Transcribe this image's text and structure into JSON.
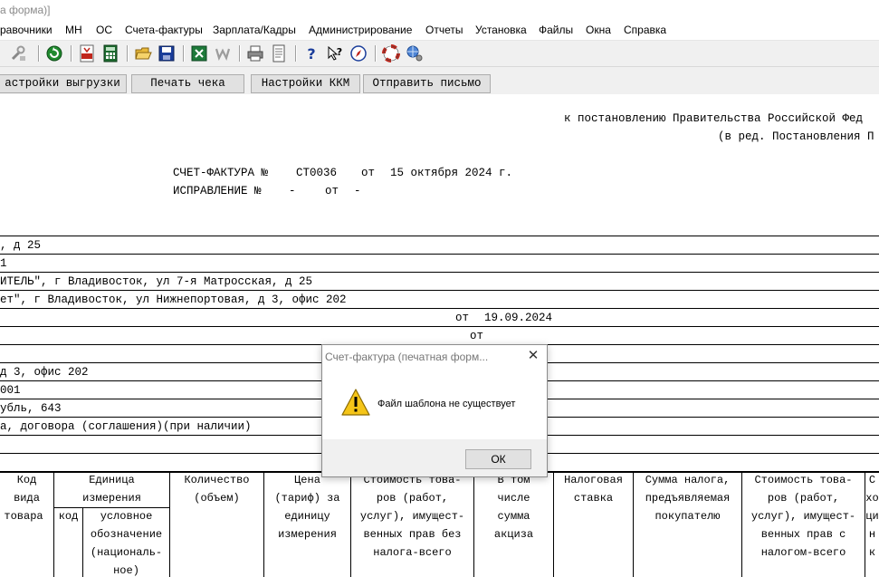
{
  "window": {
    "title": "а форма)]"
  },
  "menu": [
    "равочники",
    "МН",
    "ОС",
    "Счета-фактуры",
    "Зарплата/Кадры",
    "Администрирование",
    "Отчеты",
    "Установка",
    "Файлы",
    "Окна",
    "Справка"
  ],
  "toolbar": {
    "icons": [
      "tools-icon",
      "refresh-icon",
      "pdf-icon",
      "calculator-icon",
      "open-folder-icon",
      "save-icon",
      "excel-icon",
      "word-icon",
      "print-icon",
      "print-preview-icon",
      "help-icon",
      "context-help-icon",
      "compass-icon",
      "lifebuoy-icon",
      "web-settings-icon"
    ]
  },
  "actions": {
    "export_settings": "астройки выгрузки",
    "print_check": "Печать чека",
    "kkm_settings": "Настройки ККМ",
    "send_letter": "Отправить письмо"
  },
  "document": {
    "decree_line1": "к постановлению Правительства Российской Фед",
    "decree_line2": "(в ред. Постановления П",
    "invoice_label": "СЧЕТ-ФАКТУРА №",
    "invoice_number": "СТ0036",
    "from_label": "от",
    "invoice_date": "15 октября 2024 г.",
    "correction_label": "ИСПРАВЛЕНИЕ №",
    "correction_number": "-",
    "correction_from": "от",
    "correction_date": "-",
    "rows": [
      ", д 25",
      "1",
      "ИТЕЛЬ\", г Владивосток, ул 7-я Матросская, д 25",
      "ет\", г Владивосток, ул Нижнепортовая, д 3, офис 202",
      "",
      "",
      "",
      " д 3, офис 202",
      "001",
      "убль, 643",
      "а, договора (соглашения)(при наличии)"
    ],
    "payment_doc_from": "от",
    "payment_doc_date": "19.09.2024",
    "shipping_doc_from": "от"
  },
  "table": {
    "col_code": [
      "Код",
      "вида",
      "товара"
    ],
    "col_unit": [
      "Единица",
      "измерения"
    ],
    "col_unit_code": "код",
    "col_unit_name": [
      "условное",
      "обозначение",
      "(националь-",
      "ное)"
    ],
    "col_qty": [
      "Количество",
      "(объем)"
    ],
    "col_price": [
      "Цена",
      "(тариф) за",
      "единицу",
      "измерения"
    ],
    "col_cost_no_tax": [
      "Стоимость това-",
      "ров (работ,",
      "услуг), имущест-",
      "венных прав без",
      "налога-всего"
    ],
    "col_excise": [
      "В том",
      "числе",
      "сумма",
      "акциза"
    ],
    "col_tax_rate": [
      "Налоговая",
      "ставка"
    ],
    "col_tax_sum": [
      "Сумма налога,",
      "предъявляемая",
      "покупателю"
    ],
    "col_cost_with_tax": [
      "Стоимость това-",
      "ров (работ,",
      "услуг), имущест-",
      "венных прав с",
      "налогом-всего"
    ],
    "col_partial": [
      "С",
      "хо",
      "ци",
      "н",
      "к"
    ]
  },
  "dialog": {
    "title": "Счет-фактура (печатная форм...",
    "message": "Файл шаблона  не существует",
    "ok": "ОК"
  }
}
